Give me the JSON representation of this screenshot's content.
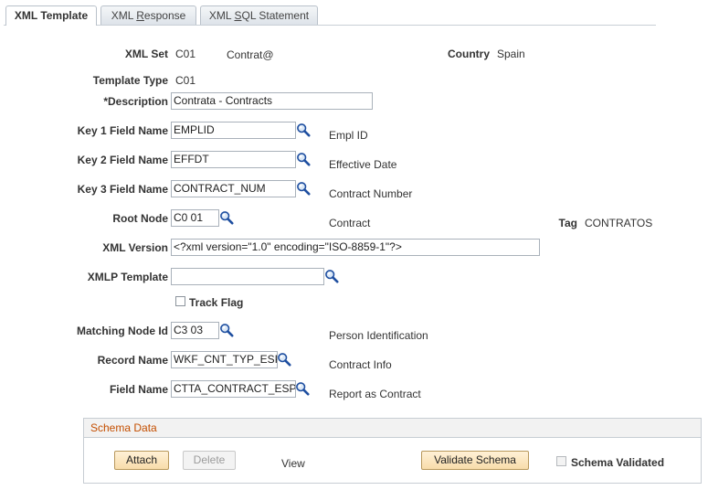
{
  "tabs": [
    {
      "label": "XML Template",
      "active": true
    },
    {
      "label_pre": "XML ",
      "label_u": "R",
      "label_post": "esponse",
      "active": false
    },
    {
      "label_pre": "XML ",
      "label_u": "S",
      "label_post": "QL Statement",
      "active": false
    }
  ],
  "form": {
    "xml_set_label": "XML Set",
    "xml_set_value": "C01",
    "xml_set_desc": "Contrat@",
    "country_label": "Country",
    "country_value": "Spain",
    "template_type_label": "Template Type",
    "template_type_value": "C01",
    "description_label": "*Description",
    "description_value": "Contrata - Contracts",
    "key1_label": "Key 1 Field Name",
    "key1_value": "EMPLID",
    "key1_desc": "Empl ID",
    "key2_label": "Key 2 Field Name",
    "key2_value": "EFFDT",
    "key2_desc": "Effective Date",
    "key3_label": "Key 3 Field Name",
    "key3_value": "CONTRACT_NUM",
    "key3_desc": "Contract Number",
    "root_node_label": "Root Node",
    "root_node_value": "C0 01",
    "root_node_desc": "Contract",
    "tag_label": "Tag",
    "tag_value": "CONTRATOS",
    "xml_version_label": "XML Version",
    "xml_version_value": "<?xml version=\"1.0\" encoding=\"ISO-8859-1\"?>",
    "xmlp_template_label": "XMLP Template",
    "xmlp_template_value": "",
    "track_flag_label": "Track Flag",
    "track_flag_checked": false,
    "matching_node_label": "Matching Node Id",
    "matching_node_value": "C3 03",
    "matching_node_desc": "Person Identification",
    "record_name_label": "Record Name",
    "record_name_value": "WKF_CNT_TYP_ESP",
    "record_name_desc": "Contract Info",
    "field_name_label": "Field Name",
    "field_name_value": "CTTA_CONTRACT_ESP",
    "field_name_desc": "Report as Contract"
  },
  "schema": {
    "title": "Schema Data",
    "attach_label": "Attach",
    "delete_label": "Delete",
    "view_label": "View",
    "validate_label": "Validate Schema",
    "validated_label": "Schema Validated",
    "validated_checked": false
  },
  "colors": {
    "group_title": "#c44e00",
    "button_fill": "#f8dcaa",
    "button_border": "#b8985c",
    "lookup_icon": "#1f4fa0"
  },
  "icons": {
    "lookup": "magnifying-glass"
  }
}
